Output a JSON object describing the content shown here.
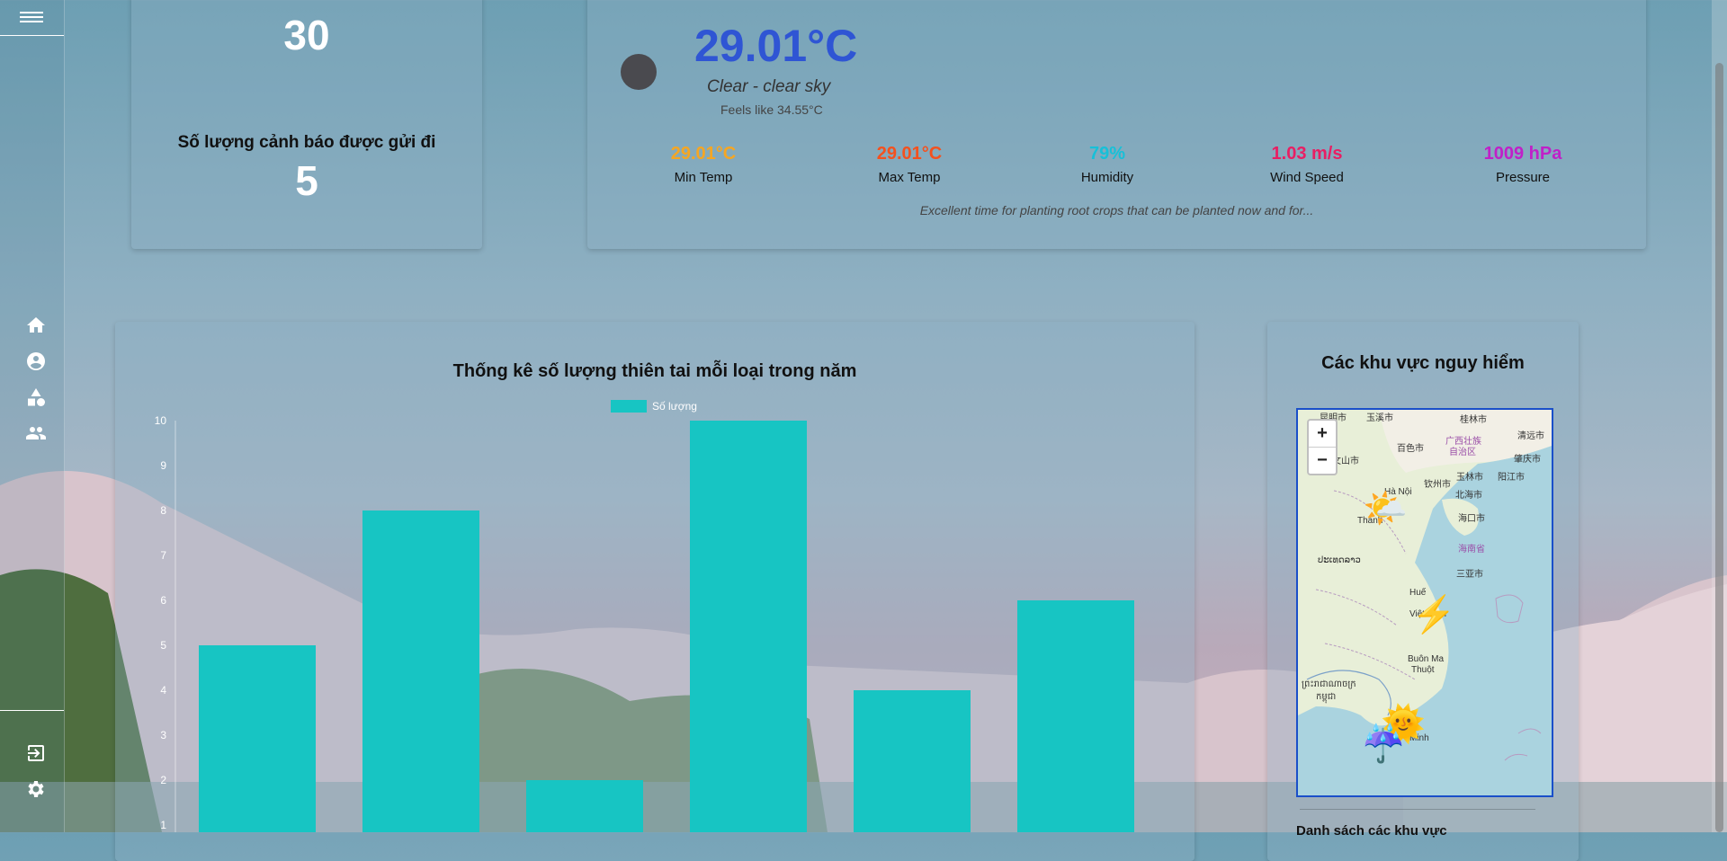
{
  "sidebar": {
    "icons": [
      "menu-icon",
      "home-icon",
      "account-circle-icon",
      "category-icon",
      "group-icon",
      "logout-icon",
      "settings-icon"
    ]
  },
  "stats": {
    "top_value": "30",
    "alerts_label": "Số lượng cảnh báo được gửi đi",
    "alerts_value": "5"
  },
  "weather": {
    "temperature": "29.01°C",
    "condition": "Clear - clear sky",
    "feels_like": "Feels like 34.55°C",
    "metrics": [
      {
        "value": "29.01°C",
        "label": "Min Temp",
        "color": "#f5a623"
      },
      {
        "value": "29.01°C",
        "label": "Max Temp",
        "color": "#f4511e"
      },
      {
        "value": "79%",
        "label": "Humidity",
        "color": "#17c0d8"
      },
      {
        "value": "1.03 m/s",
        "label": "Wind Speed",
        "color": "#e91e63"
      },
      {
        "value": "1009 hPa",
        "label": "Pressure",
        "color": "#c020c8"
      }
    ],
    "advice": "Excellent time for planting root crops that can be planted now and for..."
  },
  "chart_data": {
    "type": "bar",
    "title": "Thống kê số lượng thiên tai mỗi loại trong năm",
    "legend": "Số lượng",
    "bar_color": "#17c5c3",
    "yticks": [
      "10",
      "9",
      "8",
      "7",
      "6",
      "5",
      "4",
      "3",
      "2",
      "1"
    ],
    "ylim": [
      0,
      10
    ],
    "values": [
      5,
      8,
      2,
      10,
      4,
      6
    ]
  },
  "map": {
    "title": "Các khu vực nguy hiểm",
    "zoom_in": "+",
    "zoom_out": "−",
    "labels": [
      "昆明市",
      "玉溪市",
      "桂林市",
      "百色市",
      "广西壮族",
      "自治区",
      "文山市",
      "钦州市",
      "肇庆市",
      "清远市",
      "玉林市",
      "阳江市",
      "Hà Nội",
      "北海市",
      "Thanh",
      "海口市",
      "海南省",
      "ປະເທດລາວ",
      "三亚市",
      "Huế",
      "Việt Nam",
      "Buôn Ma",
      "Thuột",
      "ព្រះរាជាណាចក្រ",
      "កម្ពុជា",
      "Minh"
    ],
    "markers": [
      "🌤️",
      "⚡",
      "🌞",
      "☔"
    ]
  },
  "list_heading": "Danh sách các khu vực"
}
